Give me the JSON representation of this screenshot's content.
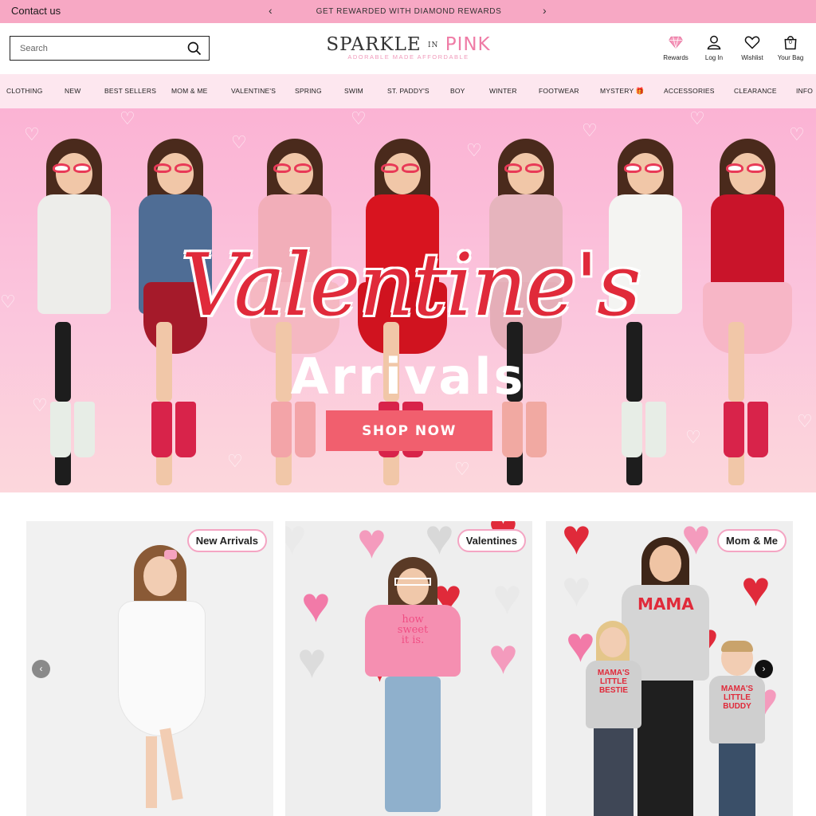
{
  "announcement": {
    "contact_label": "Contact us",
    "prev_arrow": "‹",
    "message": "GET REWARDED WITH DIAMOND REWARDS",
    "next_arrow": "›"
  },
  "header": {
    "search_placeholder": "Search",
    "logo_main": "SPARKLE",
    "logo_in": "IN",
    "logo_pink": "PINK",
    "logo_tagline": "ADORABLE MADE AFFORDABLE",
    "icons": [
      {
        "label": "Rewards",
        "icon": "diamond-icon"
      },
      {
        "label": "Log In",
        "icon": "user-icon"
      },
      {
        "label": "Wishlist",
        "icon": "heart-icon"
      },
      {
        "label": "Your Bag",
        "icon": "bag-icon",
        "count": "0"
      }
    ]
  },
  "nav": {
    "items": [
      "CLOTHING",
      "NEW",
      "BEST SELLERS",
      "MOM & ME",
      "VALENTINE'S",
      "SPRING",
      "SWIM",
      "ST. PADDY'S",
      "BOY",
      "WINTER",
      "FOOTWEAR",
      "MYSTERY 🎁",
      "ACCESSORIES",
      "CLEARANCE",
      "INFO"
    ]
  },
  "hero": {
    "title": "Valentine's",
    "subtitle": "Arrivals",
    "cta": "SHOP NOW"
  },
  "cards": [
    {
      "badge": "New Arrivals"
    },
    {
      "badge": "Valentines"
    },
    {
      "badge": "Mom & Me",
      "shirt_text": "MAMA",
      "kid_shirt_1": "MAMA'S LITTLE BESTIE",
      "kid_shirt_2": "MAMA'S LITTLE BUDDY"
    }
  ],
  "card2_shirt": "how sweet it is.",
  "carousel": {
    "prev": "‹",
    "next": "›"
  },
  "colors": {
    "announcement_bg": "#f7a8c4",
    "nav_bg": "#fde7ef",
    "cta_bg": "#f15f6e",
    "hero_script": "#e02a3a",
    "badge_border": "#f4a5c3"
  }
}
